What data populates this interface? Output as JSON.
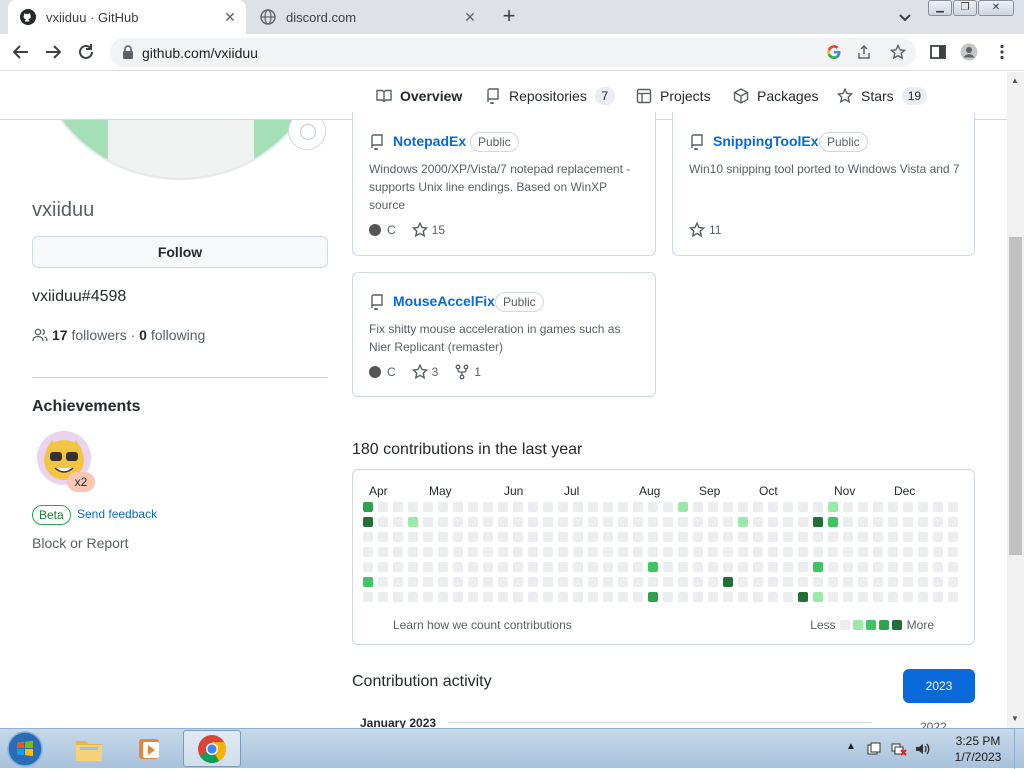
{
  "browser": {
    "tabs": [
      {
        "title": "vxiiduu · GitHub",
        "active": true
      },
      {
        "title": "discord.com",
        "active": false
      }
    ],
    "url": "github.com/vxiiduu",
    "window_buttons": [
      "minimize",
      "restore",
      "close"
    ]
  },
  "profile": {
    "username": "vxiiduu",
    "follow_label": "Follow",
    "bio": "vxiiduu#4598",
    "followers_count": "17",
    "followers_label": "followers",
    "separator": "·",
    "following_count": "0",
    "following_label": "following",
    "achievements_title": "Achievements",
    "achievement_multiplier": "x2",
    "beta_label": "Beta",
    "feedback_label": "Send feedback",
    "block_label": "Block or Report"
  },
  "nav": {
    "overview": "Overview",
    "repositories": "Repositories",
    "repositories_count": "7",
    "projects": "Projects",
    "packages": "Packages",
    "stars": "Stars",
    "stars_count": "19"
  },
  "repos": [
    {
      "name": "NotepadEx",
      "visibility": "Public",
      "description": "Windows 2000/XP/Vista/7 notepad replacement - supports Unix line endings. Based on WinXP source",
      "language": "C",
      "stars": "15"
    },
    {
      "name": "SnippingToolEx",
      "visibility": "Public",
      "description": "Win10 snipping tool ported to Windows Vista and 7",
      "stars": "11"
    },
    {
      "name": "MouseAccelFix",
      "visibility": "Public",
      "description": "Fix shitty mouse acceleration in games such as Nier Replicant (remaster)",
      "language": "C",
      "stars": "3",
      "forks": "1"
    }
  ],
  "contributions": {
    "title": "180 contributions in the last year",
    "months": [
      "Apr",
      "May",
      "Jun",
      "Jul",
      "Aug",
      "Sep",
      "Oct",
      "Nov",
      "Dec"
    ],
    "learn": "Learn how we count contributions",
    "less": "Less",
    "more": "More",
    "colors": {
      "empty": "#ebedf0",
      "l1": "#9be9a8",
      "l2": "#40c463",
      "l3": "#30a14e",
      "l4": "#216e39"
    }
  },
  "activity": {
    "title": "Contribution activity",
    "year_selected": "2023",
    "year_next": "2022",
    "month_label": "January 2023"
  },
  "taskbar": {
    "time": "3:25 PM",
    "date": "1/7/2023"
  }
}
